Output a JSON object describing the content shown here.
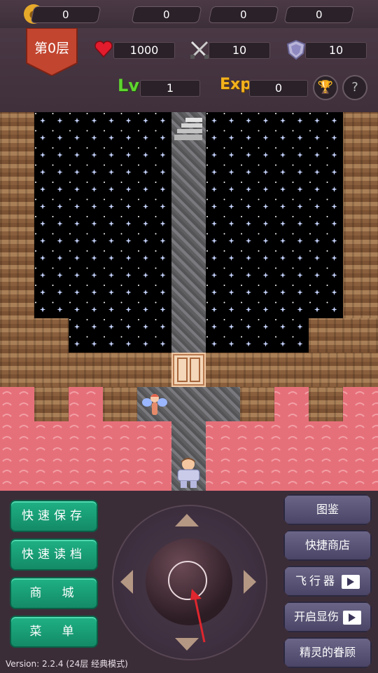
{
  "resources": {
    "coins": "0",
    "yellow_keys": "0",
    "blue_keys": "0",
    "red_keys": "0"
  },
  "floor": {
    "label": "第0层"
  },
  "stats": {
    "hp": "1000",
    "attack": "10",
    "defense": "10",
    "lv_label": "Lv",
    "lv": "1",
    "exp_label": "Exp",
    "exp": "0"
  },
  "icons": {
    "coin": "coin-icon",
    "yellow_key": "yellow-key-icon",
    "blue_key": "blue-key-icon",
    "red_key": "red-key-icon",
    "heart": "heart-icon",
    "swords": "crossed-swords-icon",
    "shield": "shield-icon",
    "trophy": "trophy-icon",
    "help": "question-icon"
  },
  "colors": {
    "hp": "#e21b2d",
    "lv": "#5fd62f",
    "exp": "#f3b21c",
    "green_button": "#1aa57b",
    "purple_button": "#5a5577",
    "lava": "#e6707a"
  },
  "left_buttons": [
    "快速保存",
    "快速读档",
    "商　城",
    "菜　单"
  ],
  "right_buttons": [
    "图鉴",
    "快捷商店",
    "飞行器",
    "开启显伤",
    "精灵的眷顾"
  ],
  "version": "Version: 2.2.4 (24层 经典模式)"
}
